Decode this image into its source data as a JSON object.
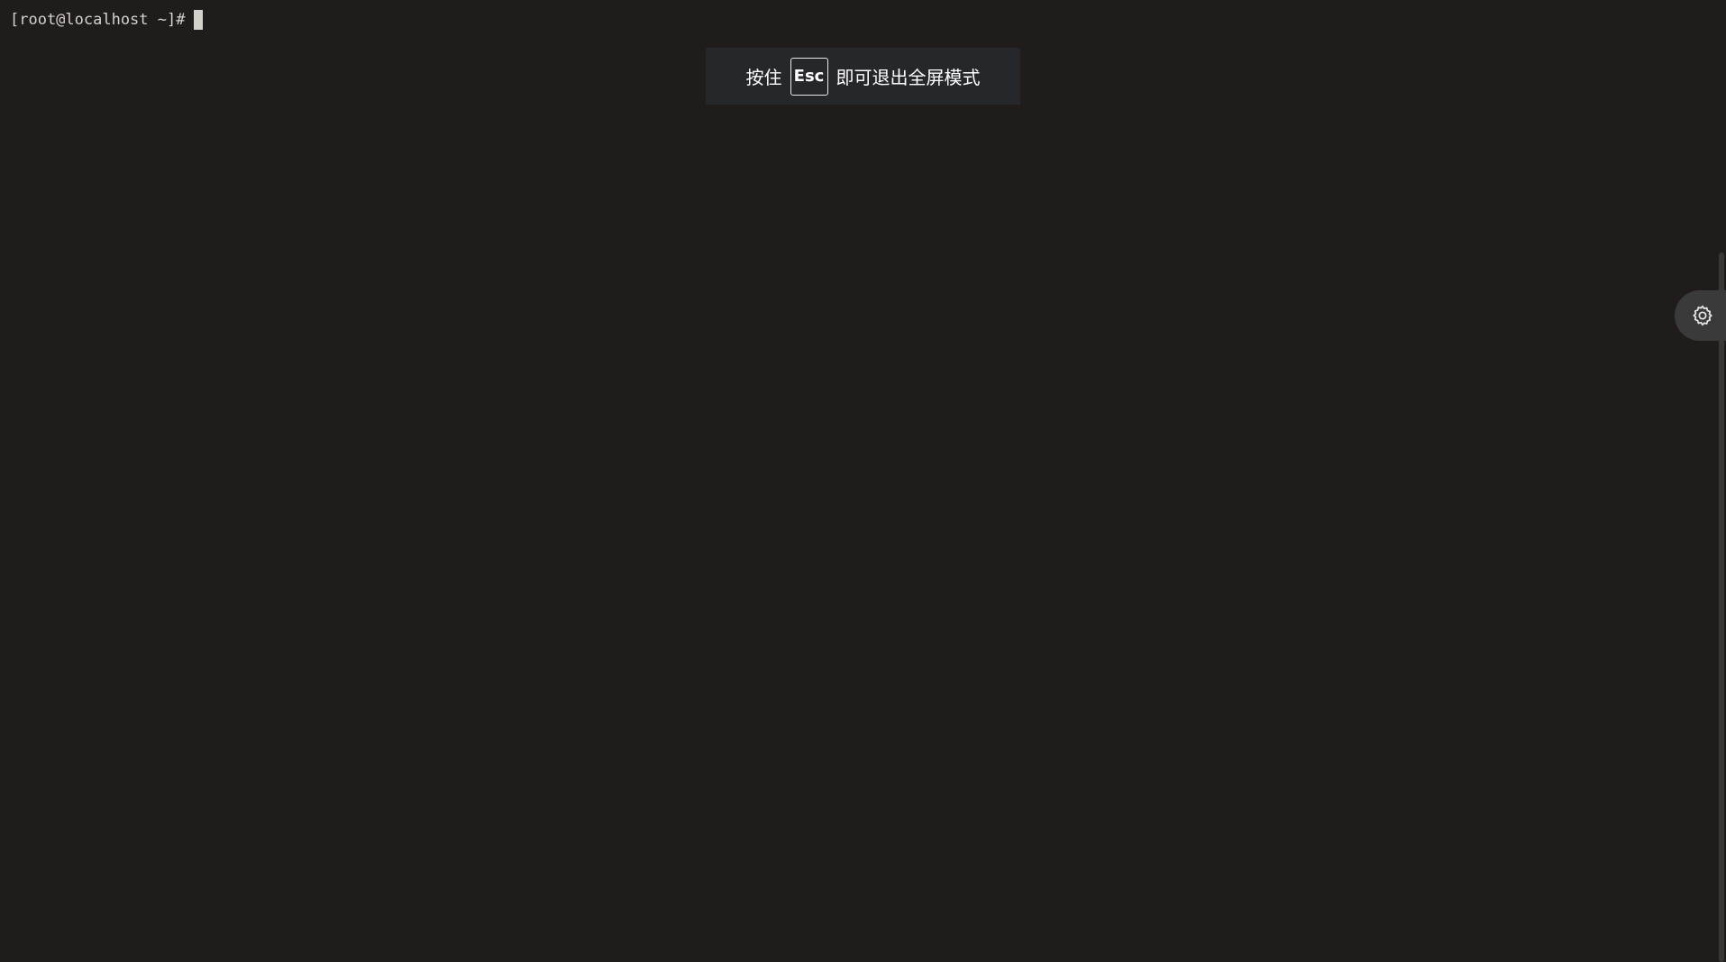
{
  "terminal": {
    "prompt": "[root@localhost ~]#"
  },
  "fullscreen_toast": {
    "text_before": "按住",
    "key_label": "Esc",
    "text_after": "即可退出全屏模式"
  },
  "icons": {
    "settings": "gear-icon"
  },
  "colors": {
    "background": "#1f1c1b",
    "foreground": "#d4d0cc",
    "toast_bg": "#25272b",
    "settings_tab_bg": "#3b3a3a"
  }
}
